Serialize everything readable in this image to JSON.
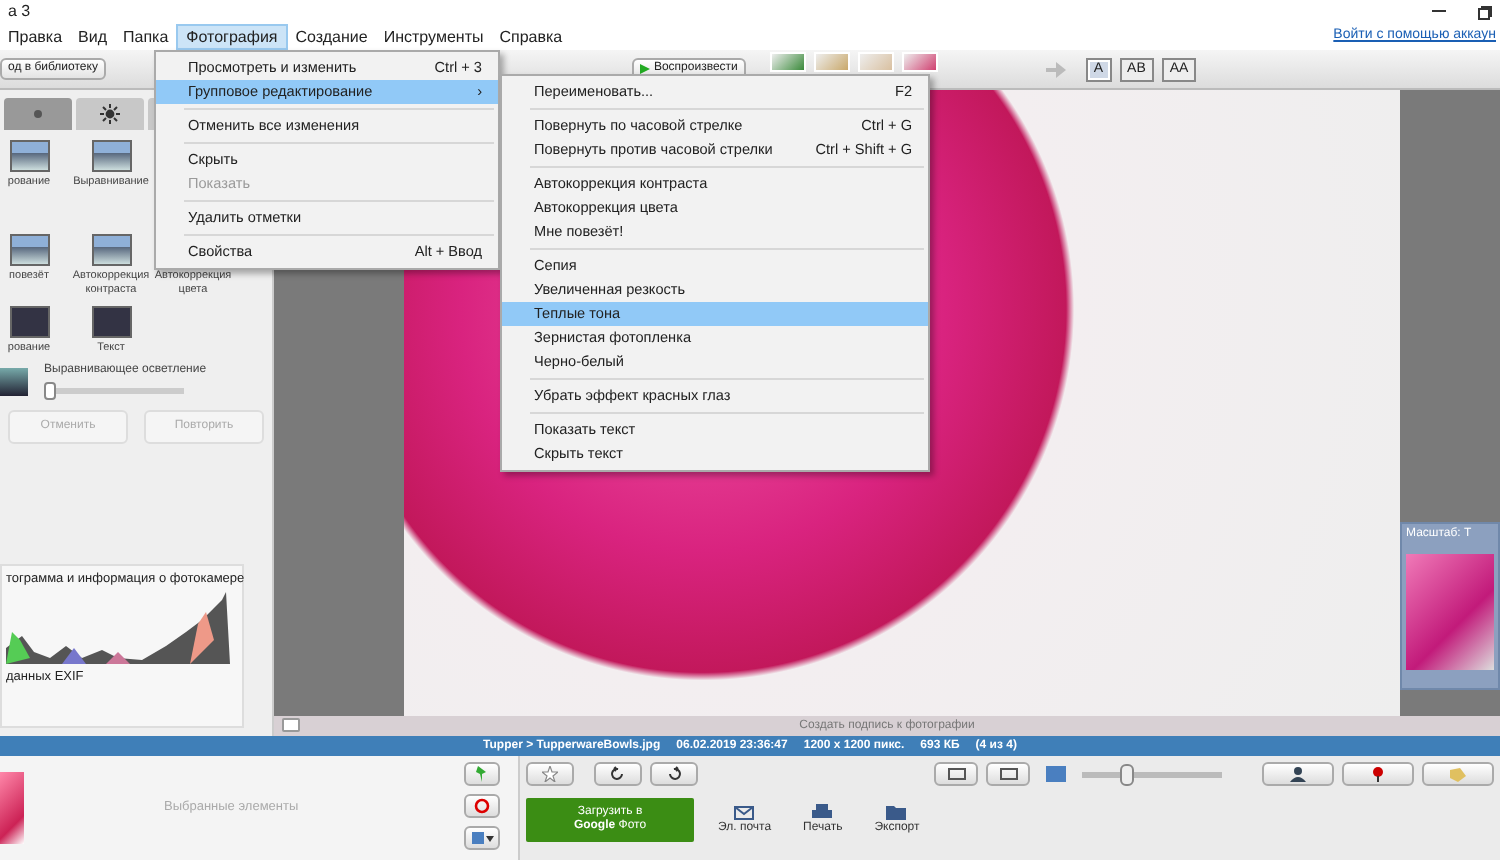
{
  "window": {
    "title": "а 3"
  },
  "menu_bar": [
    {
      "label": "Правка",
      "selected": false
    },
    {
      "label": "Вид",
      "selected": false
    },
    {
      "label": "Папка",
      "selected": false
    },
    {
      "label": "Фотография",
      "selected": true
    },
    {
      "label": "Создание",
      "selected": false
    },
    {
      "label": "Инструменты",
      "selected": false
    },
    {
      "label": "Справка",
      "selected": false
    }
  ],
  "account_link": "Войти с помощью аккаун",
  "toolbar": {
    "library_button": "од в библиотеку",
    "play_button": "Воспроизвести",
    "layout_buttons": [
      {
        "label": "A",
        "selected": true
      },
      {
        "label": "AB",
        "selected": false
      },
      {
        "label": "AA",
        "selected": false
      }
    ]
  },
  "photo_menu": [
    {
      "kind": "item",
      "label": "Просмотреть и изменить",
      "shortcut": "Ctrl + 3",
      "selected": false,
      "disabled": false
    },
    {
      "kind": "item",
      "label": "Групповое редактирование",
      "arrow": "›",
      "selected": true,
      "disabled": false
    },
    {
      "kind": "separator"
    },
    {
      "kind": "item",
      "label": "Отменить все изменения",
      "selected": false,
      "disabled": false
    },
    {
      "kind": "separator"
    },
    {
      "kind": "item",
      "label": "Скрыть",
      "selected": false,
      "disabled": false
    },
    {
      "kind": "item",
      "label": "Показать",
      "selected": false,
      "disabled": true
    },
    {
      "kind": "separator"
    },
    {
      "kind": "item",
      "label": "Удалить отметки",
      "selected": false,
      "disabled": false
    },
    {
      "kind": "separator"
    },
    {
      "kind": "item",
      "label": "Свойства",
      "shortcut": "Alt + Ввод",
      "selected": false,
      "disabled": false
    }
  ],
  "batch_menu": [
    {
      "kind": "item",
      "label": "Переименовать...",
      "shortcut": "F2",
      "selected": false
    },
    {
      "kind": "separator"
    },
    {
      "kind": "item",
      "label": "Повернуть по часовой стрелке",
      "shortcut": "Ctrl + G",
      "selected": false
    },
    {
      "kind": "item",
      "label": "Повернуть против часовой стрелки",
      "shortcut": "Ctrl + Shift + G",
      "selected": false
    },
    {
      "kind": "separator"
    },
    {
      "kind": "item",
      "label": "Автокоррекция контраста",
      "selected": false
    },
    {
      "kind": "item",
      "label": "Автокоррекция цвета",
      "selected": false
    },
    {
      "kind": "item",
      "label": "Мне повезёт!",
      "selected": false
    },
    {
      "kind": "separator"
    },
    {
      "kind": "item",
      "label": "Сепия",
      "selected": false
    },
    {
      "kind": "item",
      "label": "Увеличенная резкость",
      "selected": false
    },
    {
      "kind": "item",
      "label": "Теплые тона",
      "selected": true
    },
    {
      "kind": "item",
      "label": "Зернистая фотопленка",
      "selected": false
    },
    {
      "kind": "item",
      "label": "Черно-белый",
      "selected": false
    },
    {
      "kind": "separator"
    },
    {
      "kind": "item",
      "label": "Убрать эффект красных глаз",
      "selected": false
    },
    {
      "kind": "separator"
    },
    {
      "kind": "item",
      "label": "Показать текст",
      "selected": false
    },
    {
      "kind": "item",
      "label": "Скрыть текст",
      "selected": false
    }
  ],
  "effect_rows": [
    [
      {
        "label": "рование"
      },
      {
        "label": "Выравнивание"
      }
    ],
    [
      {
        "label": "повезёт"
      },
      {
        "label": "Автокоррекция контраста"
      },
      {
        "label": "Автокоррекция цвета"
      }
    ],
    [
      {
        "label": "рование"
      },
      {
        "label": "Текст"
      }
    ]
  ],
  "fill_light": {
    "label": "Выравнивающее осветление",
    "level": 0.0
  },
  "undo_button": {
    "label": "Отменить",
    "disabled": true
  },
  "redo_button": {
    "label": "Повторить",
    "disabled": true
  },
  "histogram": {
    "title": "тограмма и информация о фотокамере",
    "note": "данных EXIF"
  },
  "caption_placeholder": "Создать подпись к фотографии",
  "zoom_popup": {
    "title": "Масштаб: Т"
  },
  "status_bar": [
    "Tupper > TupperwareBowls.jpg",
    "06.02.2019 23:36:47",
    "1200 x 1200 пикс.",
    "693 КБ",
    "(4 из 4)"
  ],
  "tray": {
    "label": "Выбранные элементы"
  },
  "zoom_slider": {
    "level": 0.3
  },
  "upload_button": [
    "Загрузить в",
    "**Google** Фото"
  ],
  "actions": [
    "Эл. почта",
    "Печать",
    "Экспорт"
  ]
}
